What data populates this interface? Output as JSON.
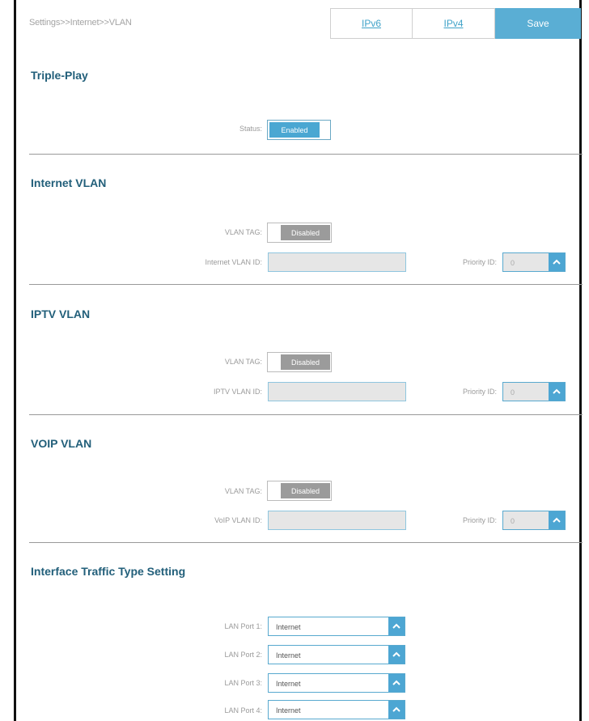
{
  "breadcrumb": "Settings>>Internet>>VLAN",
  "header": {
    "ipv6_label": "IPv6",
    "ipv4_label": "IPv4",
    "save_label": "Save"
  },
  "triple_play": {
    "title": "Triple-Play",
    "status_label": "Status:",
    "status_value": "Enabled"
  },
  "internet_vlan": {
    "title": "Internet VLAN",
    "tag_label": "VLAN TAG:",
    "tag_value": "Disabled",
    "id_label": "Internet VLAN ID:",
    "id_value": "",
    "priority_label": "Priority ID:",
    "priority_value": "0"
  },
  "iptv_vlan": {
    "title": "IPTV VLAN",
    "tag_label": "VLAN TAG:",
    "tag_value": "Disabled",
    "id_label": "IPTV VLAN ID:",
    "id_value": "",
    "priority_label": "Priority ID:",
    "priority_value": "0"
  },
  "voip_vlan": {
    "title": "VOIP VLAN",
    "tag_label": "VLAN TAG:",
    "tag_value": "Disabled",
    "id_label": "VoIP VLAN ID:",
    "id_value": "",
    "priority_label": "Priority ID:",
    "priority_value": "0"
  },
  "interface_traffic": {
    "title": "Interface Traffic Type Setting",
    "ports": [
      {
        "label": "LAN Port 1:",
        "value": "Internet"
      },
      {
        "label": "LAN Port 2:",
        "value": "Internet"
      },
      {
        "label": "LAN Port 3:",
        "value": "Internet"
      },
      {
        "label": "LAN Port 4:",
        "value": "Internet"
      }
    ]
  },
  "colors": {
    "accent": "#4da6d3",
    "title": "#225f7a",
    "disabled_toggle": "#9b9b9b"
  },
  "icons": {
    "select_arrow": "chevron-up-icon"
  }
}
